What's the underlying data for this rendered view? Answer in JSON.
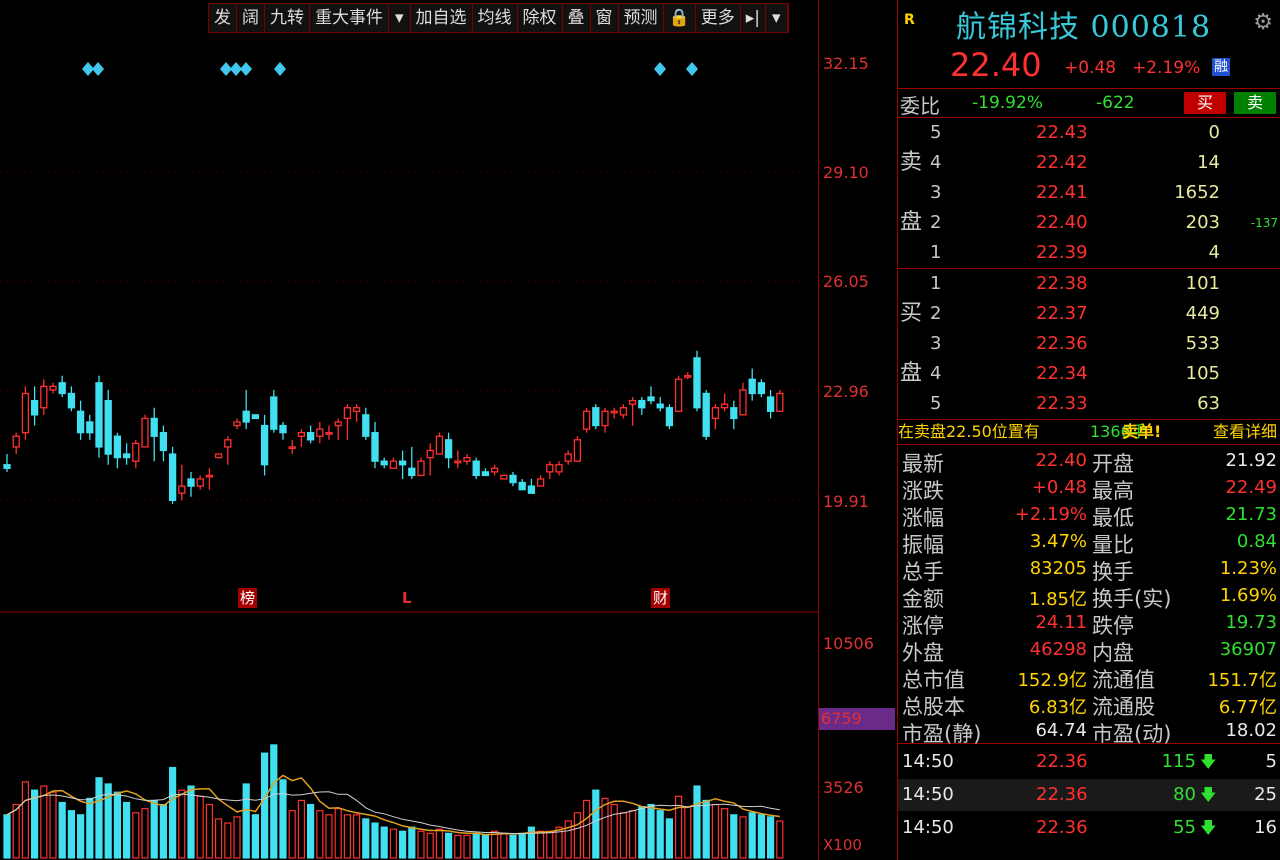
{
  "toolbar": {
    "items": [
      "发",
      "阔",
      "九转",
      "重大事件",
      "▾",
      "加自选",
      "均线",
      "除权",
      "叠",
      "窗",
      "预测",
      "🔒",
      "更多",
      "▸|",
      "▾"
    ]
  },
  "axis": {
    "price_labels": [
      "32.15",
      "29.10",
      "26.05",
      "22.96",
      "19.91"
    ],
    "volume_labels": [
      "10506",
      "3526"
    ],
    "volume_current": "6759",
    "volume_unit": "X100"
  },
  "markers": {
    "bang": "榜",
    "l": "L",
    "cai": "财"
  },
  "chart_data": {
    "type": "candlestick",
    "price_ylim": [
      19.91,
      32.15
    ],
    "volume_ylim": [
      0,
      10506
    ],
    "ohlc": [
      [
        20.9,
        21.2,
        20.7,
        20.8
      ],
      [
        21.4,
        21.8,
        21.2,
        21.7
      ],
      [
        21.8,
        23.1,
        21.6,
        22.9
      ],
      [
        22.7,
        23.1,
        22.0,
        22.3
      ],
      [
        22.5,
        23.3,
        22.3,
        23.1
      ],
      [
        23.0,
        23.2,
        22.9,
        23.1
      ],
      [
        23.2,
        23.4,
        22.8,
        22.9
      ],
      [
        22.9,
        23.1,
        22.4,
        22.5
      ],
      [
        22.4,
        22.7,
        21.6,
        21.8
      ],
      [
        22.1,
        22.3,
        21.6,
        21.8
      ],
      [
        23.2,
        23.4,
        21.1,
        21.4
      ],
      [
        22.7,
        23.0,
        20.9,
        21.2
      ],
      [
        21.7,
        21.8,
        20.8,
        21.1
      ],
      [
        21.2,
        21.5,
        20.9,
        21.1
      ],
      [
        21.0,
        21.6,
        20.8,
        21.5
      ],
      [
        21.4,
        22.3,
        21.4,
        22.2
      ],
      [
        22.2,
        22.5,
        21.0,
        21.7
      ],
      [
        21.8,
        22.0,
        21.0,
        21.3
      ],
      [
        21.2,
        21.4,
        19.8,
        19.9
      ],
      [
        20.1,
        20.9,
        19.9,
        20.3
      ],
      [
        20.5,
        20.7,
        20.0,
        20.3
      ],
      [
        20.3,
        20.6,
        20.2,
        20.5
      ],
      [
        20.6,
        20.8,
        20.2,
        20.6
      ],
      [
        21.1,
        21.2,
        21.1,
        21.2
      ],
      [
        21.4,
        21.7,
        20.9,
        21.6
      ],
      [
        22.0,
        22.2,
        21.9,
        22.1
      ],
      [
        22.4,
        23.0,
        21.9,
        22.1
      ],
      [
        22.3,
        22.3,
        22.2,
        22.2
      ],
      [
        22.0,
        22.3,
        20.6,
        20.9
      ],
      [
        22.8,
        23.0,
        21.8,
        21.9
      ],
      [
        22.0,
        22.1,
        21.6,
        21.8
      ],
      [
        21.4,
        21.6,
        21.2,
        21.4
      ],
      [
        21.7,
        21.9,
        21.4,
        21.8
      ],
      [
        21.8,
        22.0,
        21.5,
        21.6
      ],
      [
        21.7,
        22.1,
        21.5,
        21.9
      ],
      [
        21.8,
        22.0,
        21.6,
        21.8
      ],
      [
        22.0,
        22.2,
        21.6,
        22.1
      ],
      [
        22.2,
        22.6,
        21.6,
        22.5
      ],
      [
        22.4,
        22.6,
        22.1,
        22.5
      ],
      [
        22.3,
        22.5,
        21.6,
        21.7
      ],
      [
        21.8,
        22.1,
        20.8,
        21.0
      ],
      [
        21.0,
        21.1,
        20.8,
        20.9
      ],
      [
        20.8,
        21.1,
        20.9,
        21.0
      ],
      [
        21.0,
        21.3,
        20.5,
        20.9
      ],
      [
        20.8,
        21.4,
        20.5,
        20.6
      ],
      [
        20.6,
        21.1,
        20.6,
        21.0
      ],
      [
        21.1,
        21.5,
        20.6,
        21.3
      ],
      [
        21.2,
        21.8,
        21.2,
        21.7
      ],
      [
        21.6,
        21.8,
        20.8,
        21.1
      ],
      [
        21.0,
        21.3,
        20.8,
        21.0
      ],
      [
        21.0,
        21.2,
        20.9,
        21.1
      ],
      [
        21.0,
        21.1,
        20.5,
        20.6
      ],
      [
        20.7,
        20.8,
        20.6,
        20.6
      ],
      [
        20.7,
        20.9,
        20.6,
        20.8
      ],
      [
        20.5,
        20.6,
        20.5,
        20.6
      ],
      [
        20.6,
        20.7,
        20.3,
        20.4
      ],
      [
        20.4,
        20.5,
        20.2,
        20.2
      ],
      [
        20.3,
        20.5,
        20.1,
        20.1
      ],
      [
        20.3,
        20.6,
        20.3,
        20.5
      ],
      [
        20.7,
        21.0,
        20.5,
        20.9
      ],
      [
        20.7,
        21.0,
        20.6,
        20.9
      ],
      [
        21.0,
        21.3,
        20.9,
        21.2
      ],
      [
        21.0,
        21.7,
        21.0,
        21.6
      ],
      [
        21.9,
        22.5,
        21.8,
        22.4
      ],
      [
        22.5,
        22.6,
        21.9,
        22.0
      ],
      [
        22.0,
        22.5,
        21.8,
        22.4
      ],
      [
        22.4,
        22.5,
        22.2,
        22.4
      ],
      [
        22.3,
        22.6,
        22.2,
        22.5
      ],
      [
        22.6,
        22.8,
        22.0,
        22.7
      ],
      [
        22.7,
        22.8,
        22.3,
        22.5
      ],
      [
        22.8,
        23.1,
        22.6,
        22.7
      ],
      [
        22.6,
        22.8,
        22.4,
        22.5
      ],
      [
        22.5,
        22.6,
        21.9,
        22.0
      ],
      [
        22.4,
        23.4,
        22.4,
        23.3
      ],
      [
        23.4,
        23.5,
        23.3,
        23.4
      ],
      [
        23.9,
        24.1,
        22.4,
        22.5
      ],
      [
        22.9,
        23.0,
        21.6,
        21.7
      ],
      [
        22.2,
        22.6,
        21.9,
        22.5
      ],
      [
        22.5,
        22.9,
        22.4,
        22.6
      ],
      [
        22.5,
        22.7,
        21.9,
        22.2
      ],
      [
        22.3,
        23.2,
        22.3,
        23.0
      ],
      [
        23.3,
        23.6,
        22.7,
        22.9
      ],
      [
        23.2,
        23.3,
        22.8,
        22.9
      ],
      [
        22.8,
        23.0,
        22.2,
        22.4
      ],
      [
        22.4,
        23.0,
        22.4,
        22.9
      ]
    ],
    "volume": [
      2100,
      2600,
      3700,
      3300,
      3500,
      3200,
      2700,
      2300,
      2100,
      2900,
      3900,
      3600,
      3200,
      2700,
      2200,
      2400,
      2800,
      2600,
      4400,
      3300,
      3500,
      3000,
      2600,
      1900,
      1700,
      2000,
      3600,
      2100,
      5100,
      5500,
      3800,
      2300,
      2800,
      2600,
      2300,
      2100,
      2400,
      2100,
      2100,
      1900,
      1700,
      1500,
      1400,
      1300,
      1500,
      1300,
      1200,
      1400,
      1200,
      1100,
      1100,
      1200,
      1100,
      1300,
      1200,
      1100,
      1200,
      1500,
      1300,
      1300,
      1500,
      1800,
      2200,
      2800,
      3300,
      2900,
      2600,
      2200,
      2300,
      2500,
      2600,
      2300,
      1900,
      3000,
      2500,
      3500,
      2800,
      2600,
      2400,
      2100,
      2000,
      2200,
      2100,
      2000,
      1800
    ]
  },
  "quote": {
    "r_badge": "R",
    "name": "航锦科技 000818",
    "price": "22.40",
    "change": "+0.48",
    "change_pct": "+2.19%",
    "rong_badge": "融",
    "weibi_label": "委比",
    "weibi_pct": "-19.92%",
    "weicha": "-622",
    "buy_btn": "买",
    "sell_btn": "卖"
  },
  "order_book": {
    "sell_label": "卖盘",
    "buy_label": "买盘",
    "sell": [
      {
        "level": "5",
        "price": "22.43",
        "qty": "0",
        "extra": ""
      },
      {
        "level": "4",
        "price": "22.42",
        "qty": "14",
        "extra": ""
      },
      {
        "level": "3",
        "price": "22.41",
        "qty": "1652",
        "extra": ""
      },
      {
        "level": "2",
        "price": "22.40",
        "qty": "203",
        "extra": "-137"
      },
      {
        "level": "1",
        "price": "22.39",
        "qty": "4",
        "extra": ""
      }
    ],
    "buy": [
      {
        "level": "1",
        "price": "22.38",
        "qty": "101",
        "extra": ""
      },
      {
        "level": "2",
        "price": "22.37",
        "qty": "449",
        "extra": ""
      },
      {
        "level": "3",
        "price": "22.36",
        "qty": "533",
        "extra": ""
      },
      {
        "level": "4",
        "price": "22.34",
        "qty": "105",
        "extra": ""
      },
      {
        "level": "5",
        "price": "22.33",
        "qty": "63",
        "extra": ""
      }
    ]
  },
  "notice": {
    "text": "在卖盘22.50位置有",
    "qty": "1366手",
    "tag": "卖单!",
    "link": "查看详细"
  },
  "stats": [
    {
      "k1": "最新",
      "v1": "22.40",
      "c1": "red",
      "k2": "开盘",
      "v2": "21.92",
      "c2": "white"
    },
    {
      "k1": "涨跌",
      "v1": "+0.48",
      "c1": "red",
      "k2": "最高",
      "v2": "22.49",
      "c2": "red"
    },
    {
      "k1": "涨幅",
      "v1": "+2.19%",
      "c1": "red",
      "k2": "最低",
      "v2": "21.73",
      "c2": "green"
    },
    {
      "k1": "振幅",
      "v1": "3.47%",
      "c1": "yellow",
      "k2": "量比",
      "v2": "0.84",
      "c2": "green"
    },
    {
      "k1": "总手",
      "v1": "83205",
      "c1": "yellow",
      "k2": "换手",
      "v2": "1.23%",
      "c2": "yellow"
    },
    {
      "k1": "金额",
      "v1": "1.85亿",
      "c1": "yellow",
      "k2": "换手(实)",
      "v2": "1.69%",
      "c2": "yellow"
    },
    {
      "k1": "涨停",
      "v1": "24.11",
      "c1": "red",
      "k2": "跌停",
      "v2": "19.73",
      "c2": "green"
    },
    {
      "k1": "外盘",
      "v1": "46298",
      "c1": "red",
      "k2": "内盘",
      "v2": "36907",
      "c2": "green"
    },
    {
      "k1": "总市值",
      "v1": "152.9亿",
      "c1": "yellow",
      "k2": "流通值",
      "v2": "151.7亿",
      "c2": "yellow"
    },
    {
      "k1": "总股本",
      "v1": "6.83亿",
      "c1": "yellow",
      "k2": "流通股",
      "v2": "6.77亿",
      "c2": "yellow"
    },
    {
      "k1": "市盈(静)",
      "v1": "64.74",
      "c1": "white",
      "k2": "市盈(动)",
      "v2": "18.02",
      "c2": "white"
    }
  ],
  "ticks": [
    {
      "time": "14:50",
      "price": "22.36",
      "vol": "115",
      "num": "5"
    },
    {
      "time": "14:50",
      "price": "22.36",
      "vol": "80",
      "num": "25"
    },
    {
      "time": "14:50",
      "price": "22.36",
      "vol": "55",
      "num": "16"
    }
  ],
  "colors": {
    "up": "#ff3030",
    "down": "#40e0f0",
    "ma": "#e0a020",
    "grid": "#9a0000"
  }
}
